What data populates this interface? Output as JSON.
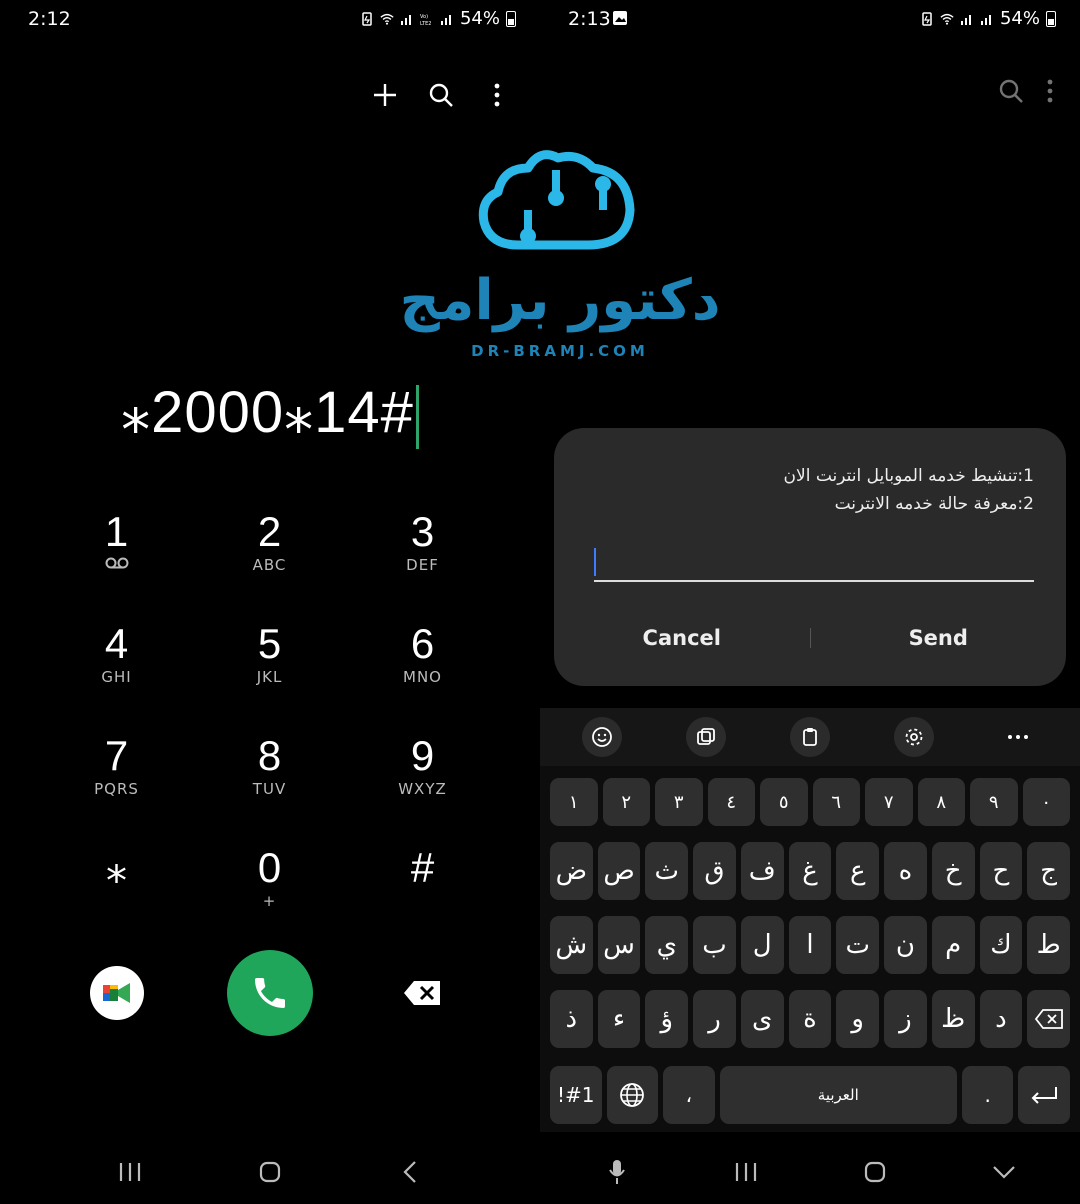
{
  "left": {
    "status": {
      "time": "2:12",
      "battery": "54%"
    },
    "dialed_number": "⁎2000⁎14#",
    "keypad": [
      {
        "digit": "1",
        "letters": ""
      },
      {
        "digit": "2",
        "letters": "ABC"
      },
      {
        "digit": "3",
        "letters": "DEF"
      },
      {
        "digit": "4",
        "letters": "GHI"
      },
      {
        "digit": "5",
        "letters": "JKL"
      },
      {
        "digit": "6",
        "letters": "MNO"
      },
      {
        "digit": "7",
        "letters": "PQRS"
      },
      {
        "digit": "8",
        "letters": "TUV"
      },
      {
        "digit": "9",
        "letters": "WXYZ"
      },
      {
        "digit": "⁎",
        "letters": ""
      },
      {
        "digit": "0",
        "letters": "+"
      },
      {
        "digit": "#",
        "letters": ""
      }
    ],
    "call_color": "#1fa65a"
  },
  "watermark": {
    "title": "دكتور برامج",
    "url": "DR-BRAMJ.COM",
    "color": "#1e84b8"
  },
  "right": {
    "status": {
      "time": "2:13",
      "battery": "54%"
    },
    "dialog": {
      "line1": "1:تنشيط خدمه الموبايل انترنت الان",
      "line2": "2:معرفة حالة خدمه الانترنت",
      "cancel": "Cancel",
      "send": "Send"
    },
    "keyboard": {
      "digits": [
        "١",
        "٢",
        "٣",
        "٤",
        "٥",
        "٦",
        "٧",
        "٨",
        "٩",
        "٠"
      ],
      "row1": [
        "ض",
        "ص",
        "ث",
        "ق",
        "ف",
        "غ",
        "ع",
        "ه",
        "خ",
        "ح",
        "ج"
      ],
      "row2": [
        "ش",
        "س",
        "ي",
        "ب",
        "ل",
        "ا",
        "ت",
        "ن",
        "م",
        "ك",
        "ط"
      ],
      "row3": [
        "ذ",
        "ء",
        "ؤ",
        "ر",
        "ى",
        "ة",
        "و",
        "ز",
        "ظ",
        "د"
      ],
      "symbols": "!#1",
      "comma": "،",
      "space": "العربية",
      "period": "."
    }
  }
}
